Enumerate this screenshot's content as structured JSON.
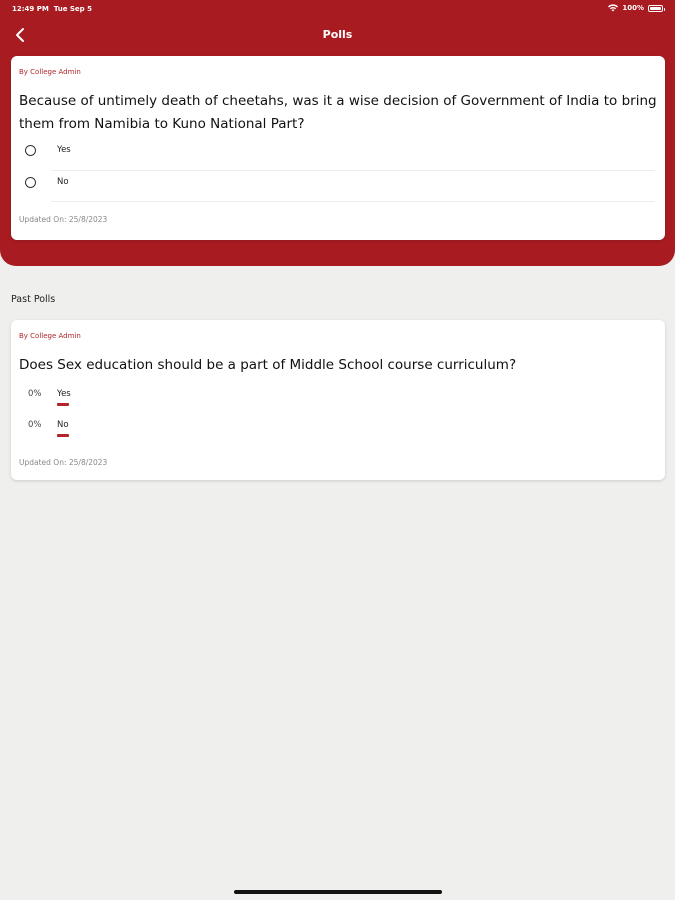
{
  "status_bar": {
    "time": "12:49 PM",
    "date": "Tue Sep 5",
    "battery": "100%"
  },
  "nav": {
    "title": "Polls"
  },
  "active_poll": {
    "author": "By College Admin",
    "question": "Because of untimely death of cheetahs, was it a wise decision of Government of India to bring them from Namibia to Kuno National Part?",
    "options": [
      {
        "label": "Yes"
      },
      {
        "label": "No"
      }
    ],
    "updated": "Updated On: 25/8/2023"
  },
  "past_polls": {
    "section_title": "Past Polls",
    "items": [
      {
        "author": "By College Admin",
        "question": "Does Sex education should be a part of Middle School course curriculum?",
        "results": [
          {
            "percent": "0%",
            "label": "Yes"
          },
          {
            "percent": "0%",
            "label": "No"
          }
        ],
        "updated": "Updated On: 25/8/2023"
      }
    ]
  },
  "colors": {
    "brand": "#a81c21",
    "background": "#efefed"
  }
}
